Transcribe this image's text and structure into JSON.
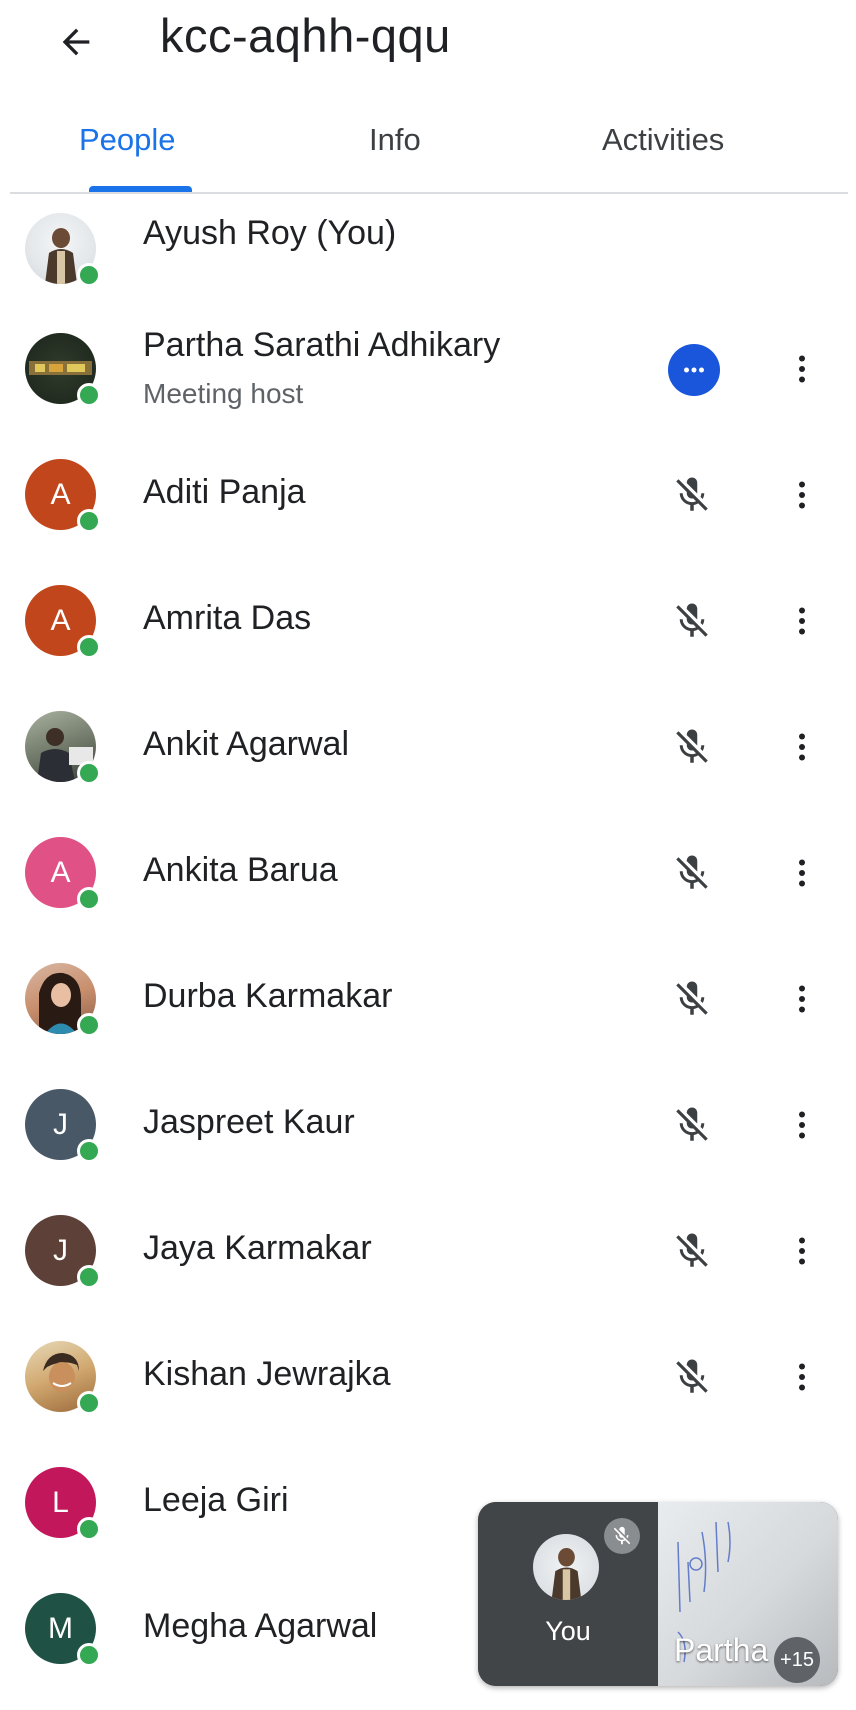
{
  "header": {
    "title": "kcc-aqhh-qqu",
    "back_icon": "arrow-back-icon"
  },
  "tabs": [
    {
      "label": "People",
      "active": true
    },
    {
      "label": "Info",
      "active": false
    },
    {
      "label": "Activities",
      "active": false
    }
  ],
  "colors": {
    "accent": "#1a73e8",
    "online": "#34a853",
    "host_badge": "#1a56db"
  },
  "participants": [
    {
      "name": "Ayush Roy (You)",
      "avatar_type": "photo",
      "online": true
    },
    {
      "name": "Partha Sarathi Adhikary",
      "subtitle": "Meeting host",
      "avatar_type": "photo",
      "online": true,
      "status_icon": "more-horiz-badge-icon"
    },
    {
      "name": "Aditi Panja",
      "initial": "A",
      "avatar_color": "#c2461b",
      "online": true,
      "mic": "mic-off-icon"
    },
    {
      "name": "Amrita Das",
      "initial": "A",
      "avatar_color": "#c2461b",
      "online": true,
      "mic": "mic-off-icon"
    },
    {
      "name": "Ankit Agarwal",
      "avatar_type": "photo",
      "online": true,
      "mic": "mic-off-icon"
    },
    {
      "name": "Ankita Barua",
      "initial": "A",
      "avatar_color": "#e05185",
      "online": true,
      "mic": "mic-off-icon"
    },
    {
      "name": "Durba Karmakar",
      "avatar_type": "photo",
      "online": true,
      "mic": "mic-off-icon"
    },
    {
      "name": "Jaspreet Kaur",
      "initial": "J",
      "avatar_color": "#485867",
      "online": true,
      "mic": "mic-off-icon"
    },
    {
      "name": "Jaya Karmakar",
      "initial": "J",
      "avatar_color": "#5d4037",
      "online": true,
      "mic": "mic-off-icon"
    },
    {
      "name": "Kishan Jewrajka",
      "avatar_type": "photo",
      "online": true,
      "mic": "mic-off-icon"
    },
    {
      "name": "Leeja Giri",
      "initial": "L",
      "avatar_color": "#c2185b",
      "online": true
    },
    {
      "name": "Megha Agarwal",
      "initial": "M",
      "avatar_color": "#1f5245",
      "online": true
    }
  ],
  "pip": {
    "you_label": "You",
    "partha_label": "Partha",
    "more_count": "+15"
  }
}
